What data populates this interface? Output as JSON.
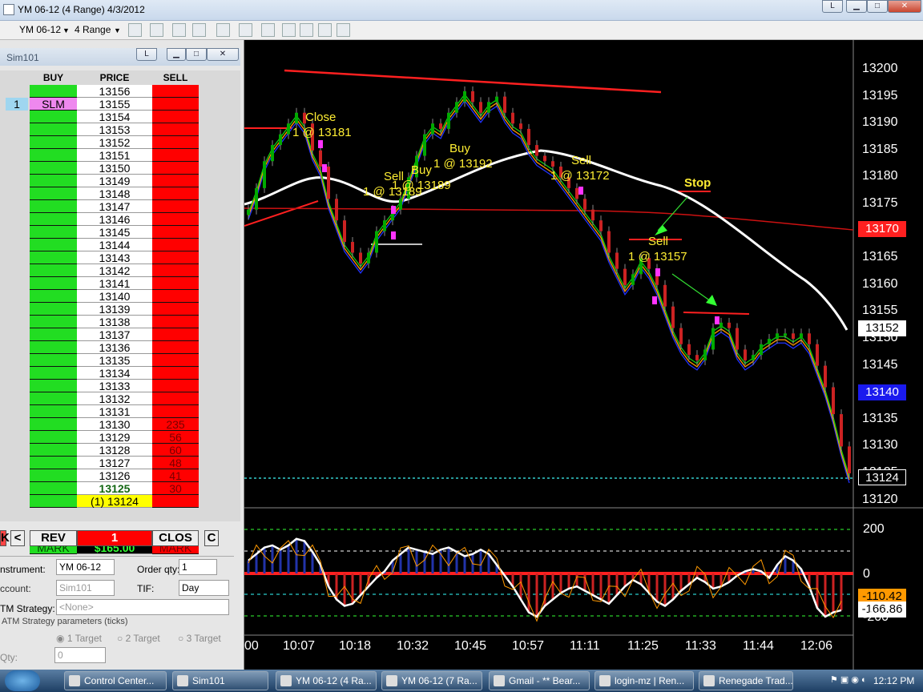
{
  "window": {
    "title": "YM 06-12 (4 Range)  4/3/2012",
    "tool_l": "L",
    "min": "▁",
    "max": "□",
    "close": "✕"
  },
  "toolbar": {
    "instrument": "YM 06-12",
    "interval": "4 Range",
    "icons": [
      "bars-icon",
      "pencil-icon",
      "crosshair-icon",
      "zoom-icon",
      "chart-properties-icon",
      "indicators-icon",
      "strategies-icon",
      "data-box-icon"
    ]
  },
  "dom": {
    "title": "Sim101",
    "l_button": "L",
    "headers": {
      "buy": "BUY",
      "price": "PRICE",
      "sell": "SELL"
    },
    "rows": [
      {
        "price": "13156",
        "sell": ""
      },
      {
        "price": "13155",
        "sell": "",
        "buy_order": "SLM",
        "position": "1"
      },
      {
        "price": "13154",
        "sell": ""
      },
      {
        "price": "13153",
        "sell": ""
      },
      {
        "price": "13152",
        "sell": ""
      },
      {
        "price": "13151",
        "sell": ""
      },
      {
        "price": "13150",
        "sell": ""
      },
      {
        "price": "13149",
        "sell": ""
      },
      {
        "price": "13148",
        "sell": ""
      },
      {
        "price": "13147",
        "sell": ""
      },
      {
        "price": "13146",
        "sell": ""
      },
      {
        "price": "13145",
        "sell": ""
      },
      {
        "price": "13144",
        "sell": ""
      },
      {
        "price": "13143",
        "sell": ""
      },
      {
        "price": "13142",
        "sell": ""
      },
      {
        "price": "13141",
        "sell": ""
      },
      {
        "price": "13140",
        "sell": ""
      },
      {
        "price": "13139",
        "sell": ""
      },
      {
        "price": "13138",
        "sell": ""
      },
      {
        "price": "13137",
        "sell": ""
      },
      {
        "price": "13136",
        "sell": ""
      },
      {
        "price": "13135",
        "sell": ""
      },
      {
        "price": "13134",
        "sell": ""
      },
      {
        "price": "13133",
        "sell": ""
      },
      {
        "price": "13132",
        "sell": ""
      },
      {
        "price": "13131",
        "sell": ""
      },
      {
        "price": "13130",
        "sell": "235"
      },
      {
        "price": "13129",
        "sell": "56"
      },
      {
        "price": "13128",
        "sell": "60"
      },
      {
        "price": "13127",
        "sell": "48"
      },
      {
        "price": "13126",
        "sell": "41"
      },
      {
        "price": "13125",
        "sell": "30",
        "bold": true
      },
      {
        "price": "(1) 13124",
        "sell": "",
        "last": true
      }
    ],
    "mark_left": "MARK",
    "pnl": "$165.00",
    "mark_right": "MARK",
    "x_label": "K",
    "left_arrow": "<",
    "rev": "REV",
    "qty_display": "1",
    "clos": "CLOS",
    "c_label": "C",
    "instrument_label": "nstrument:",
    "instrument_value": "YM 06-12",
    "order_qty_label": "Order qty:",
    "order_qty_value": "1",
    "account_label": "ccount:",
    "account_value": "Sim101",
    "tif_label": "TIF:",
    "tif_value": "Day",
    "atm_label": "TM Strategy:",
    "atm_value": "<None>",
    "atm_params": "ATM Strategy parameters (ticks)",
    "target1": "1 Target",
    "target2": "2 Target",
    "target3": "3 Target",
    "qty_label": "Qty:",
    "qty_value": "0"
  },
  "chart": {
    "price_labels": [
      "13200",
      "13195",
      "13190",
      "13185",
      "13180",
      "13175",
      "13170",
      "13165",
      "13160",
      "13155",
      "13150",
      "13145",
      "13140",
      "13135",
      "13130",
      "13125",
      "13120"
    ],
    "tag_red": "13170",
    "tag_white": "13152",
    "tag_blue": "13140",
    "tag_last": "13124",
    "osc_labels": [
      "200",
      "0",
      "-200"
    ],
    "tag_orange": "-110.42",
    "tag_osc_white": "-166.86",
    "time_labels": [
      "00",
      "10:07",
      "10:18",
      "10:32",
      "10:45",
      "10:57",
      "11:11",
      "11:25",
      "11:33",
      "11:44",
      "12:06"
    ],
    "annotations": {
      "close": "Close",
      "close_fill": "1 @ 13181",
      "sell1": "Sell",
      "sell1_fill": "1 @ 13189",
      "buy1": "Buy",
      "buy1_fill": "1 @ 13189",
      "buy2": "Buy",
      "buy2_fill": "1 @ 13192",
      "sell2": "Sell",
      "sell2_fill": "1 @ 13172",
      "stop": "Stop",
      "sell3": "Sell",
      "sell3_fill": "1 @ 13157"
    },
    "colors": {
      "up": "#00cc00",
      "down": "#ff2020",
      "accent": "#ffee33"
    }
  },
  "taskbar": {
    "items": [
      "Control Center...",
      "Sim101",
      "YM 06-12 (4 Ra...",
      "YM 06-12 (7 Ra...",
      "Gmail - ** Bear...",
      "login-mz | Ren...",
      "Renegade Trad..."
    ],
    "clock": "12:12 PM"
  }
}
